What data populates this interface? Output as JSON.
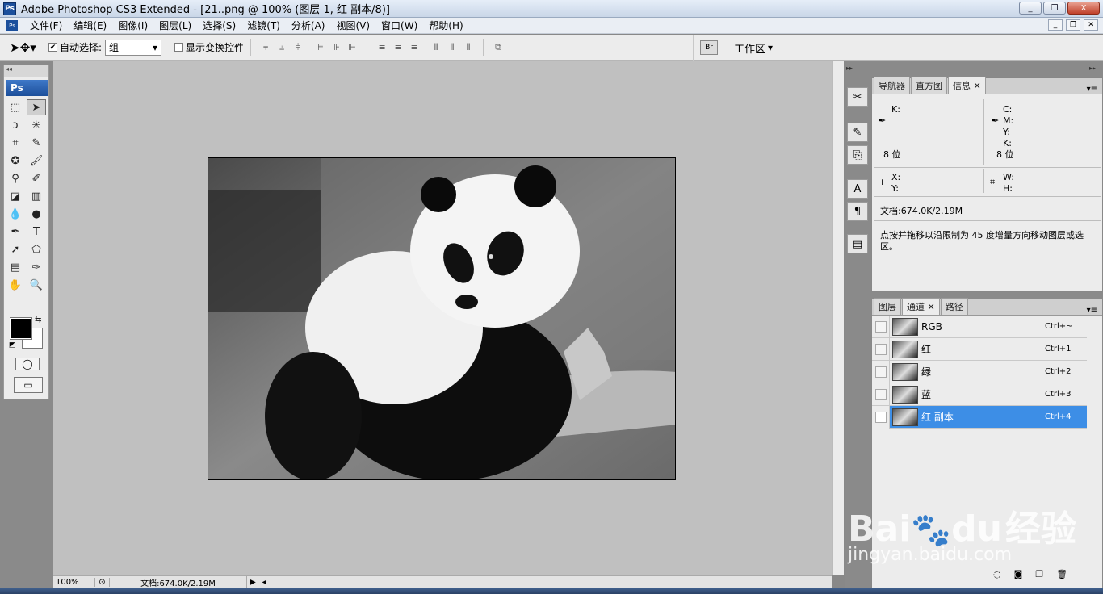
{
  "window": {
    "title": "Adobe Photoshop CS3 Extended - [21..png @ 100% (图层 1, 红 副本/8)]",
    "ps_logo": "Ps",
    "min_label": "_",
    "max_label": "❐",
    "close_label": "X"
  },
  "menu": {
    "items": [
      "文件(F)",
      "编辑(E)",
      "图像(I)",
      "图层(L)",
      "选择(S)",
      "滤镜(T)",
      "分析(A)",
      "视图(V)",
      "窗口(W)",
      "帮助(H)"
    ]
  },
  "options": {
    "auto_select_label": "自动选择:",
    "auto_select_checked": "✔",
    "auto_select_value": "组",
    "show_transform_label": "显示变换控件",
    "workspace_label": "工作区"
  },
  "toolbox": {
    "badge": "Ps"
  },
  "status": {
    "zoom": "100%",
    "doc": "文档:674.0K/2.19M"
  },
  "info_panel": {
    "tabs": [
      "导航器",
      "直方图",
      "信息"
    ],
    "k_label": "K:",
    "c_label": "C:",
    "m_label": "M:",
    "y_label": "Y:",
    "k2_label": "K:",
    "bits_left": "8 位",
    "bits_right": "8 位",
    "x_label": "X:",
    "y2_label": "Y:",
    "w_label": "W:",
    "h_label": "H:",
    "doc": "文档:674.0K/2.19M",
    "hint": "点按并拖移以沿限制为 45 度增量方向移动图层或选区。"
  },
  "channels_panel": {
    "tabs": [
      "图层",
      "通道",
      "路径"
    ],
    "rows": [
      {
        "name": "RGB",
        "shortcut": "Ctrl+~",
        "visible": ""
      },
      {
        "name": "红",
        "shortcut": "Ctrl+1",
        "visible": ""
      },
      {
        "name": "绿",
        "shortcut": "Ctrl+2",
        "visible": ""
      },
      {
        "name": "蓝",
        "shortcut": "Ctrl+3",
        "visible": ""
      },
      {
        "name": "红 副本",
        "shortcut": "Ctrl+4",
        "visible": "👁"
      }
    ]
  },
  "watermark": {
    "brand": "Bai",
    "brand2": "du",
    "cn": "经验",
    "url": "jingyan.baidu.com"
  }
}
